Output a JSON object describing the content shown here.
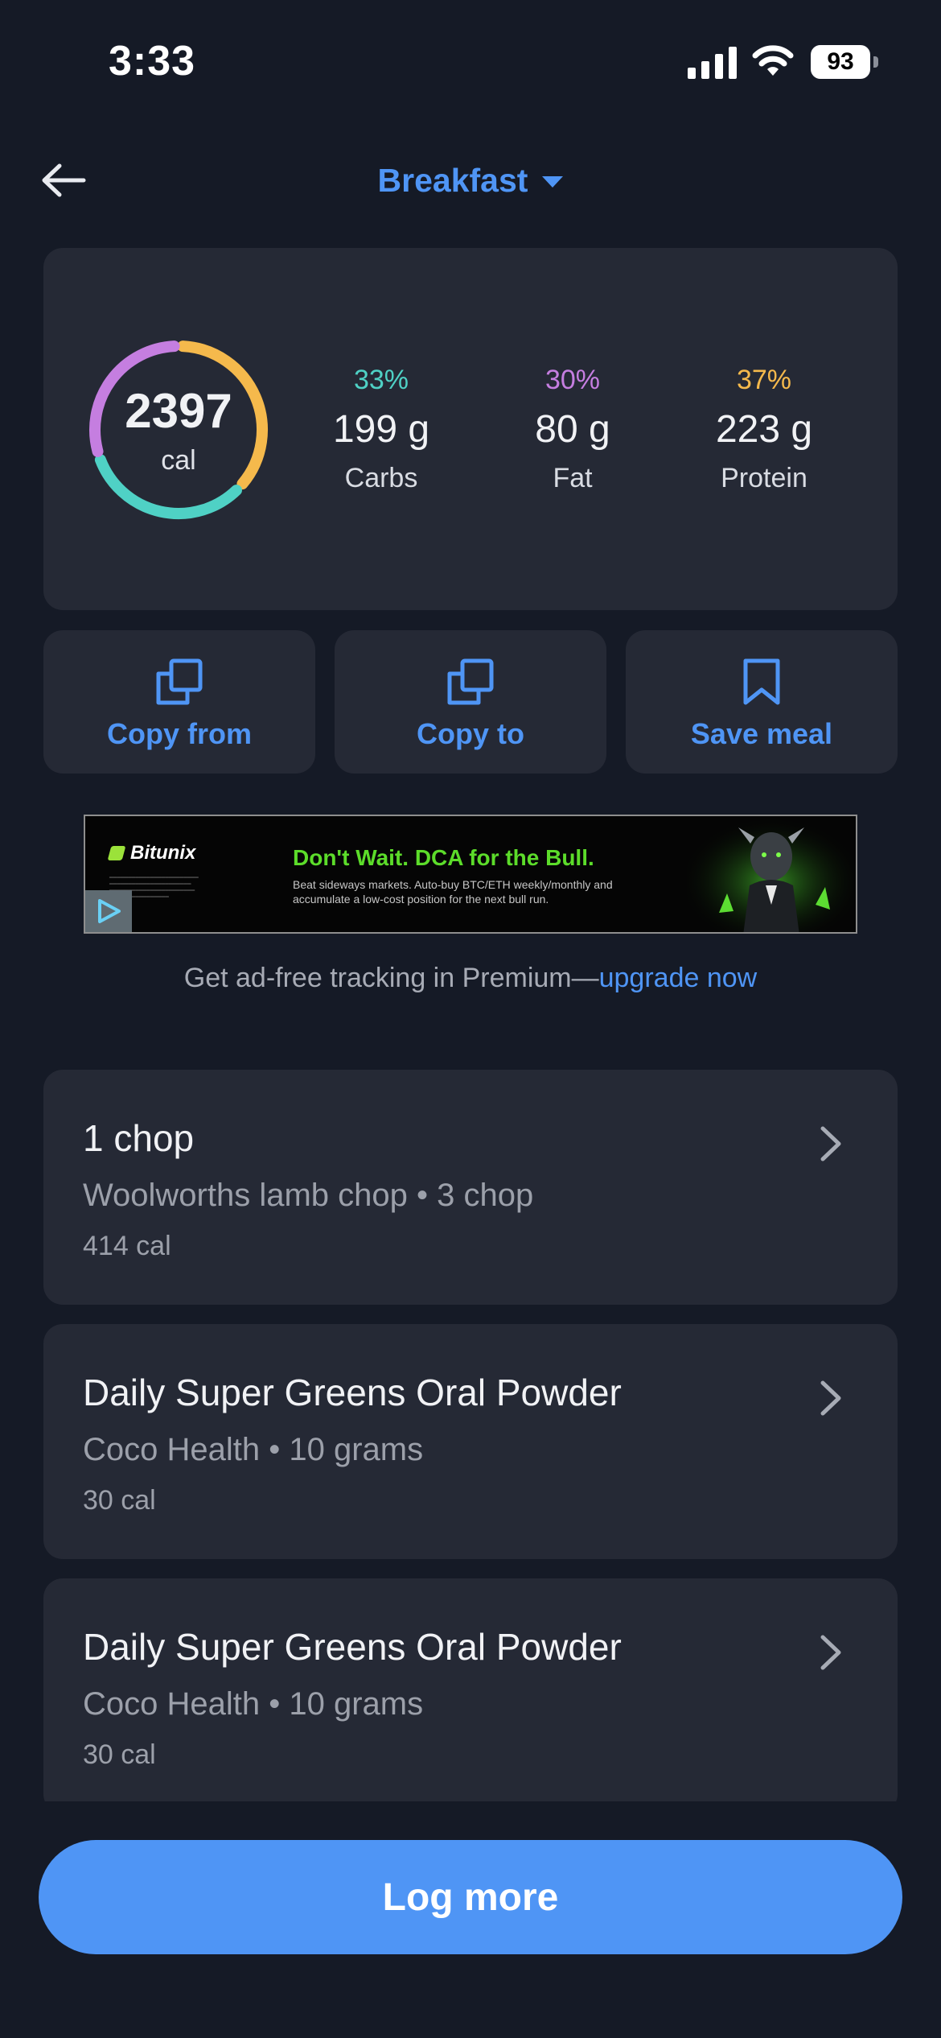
{
  "status_bar": {
    "time": "3:33",
    "battery": "93"
  },
  "header": {
    "title": "Breakfast"
  },
  "summary": {
    "calories": "2397",
    "calories_unit": "cal",
    "macros": [
      {
        "percent": "33%",
        "amount": "199 g",
        "label": "Carbs",
        "color": "#4fd1c5",
        "fraction": 0.33
      },
      {
        "percent": "30%",
        "amount": "80 g",
        "label": "Fat",
        "color": "#c57ee0",
        "fraction": 0.3
      },
      {
        "percent": "37%",
        "amount": "223 g",
        "label": "Protein",
        "color": "#f5b94c",
        "fraction": 0.37
      }
    ]
  },
  "actions": {
    "copy_from": "Copy from",
    "copy_to": "Copy to",
    "save_meal": "Save meal"
  },
  "ad": {
    "brand": "Bitunix",
    "headline": "Don't Wait. DCA for the Bull.",
    "body": "Beat sideways markets. Auto-buy BTC/ETH weekly/monthly and accumulate a low-cost position for the next bull run."
  },
  "premium": {
    "text": "Get ad-free tracking in Premium—",
    "link": "upgrade now"
  },
  "foods": [
    {
      "name": "1 chop",
      "brand": "Woolworths lamb chop",
      "serving": "3 chop",
      "calories": "414 cal"
    },
    {
      "name": "Daily Super Greens Oral Powder",
      "brand": "Coco Health",
      "serving": "10 grams",
      "calories": "30 cal"
    },
    {
      "name": "Daily Super Greens Oral Powder",
      "brand": "Coco Health",
      "serving": "10 grams",
      "calories": "30 cal"
    }
  ],
  "footer": {
    "log_more": "Log more"
  },
  "colors": {
    "accent": "#4f95f5",
    "background": "#151a26",
    "card": "#252935"
  }
}
